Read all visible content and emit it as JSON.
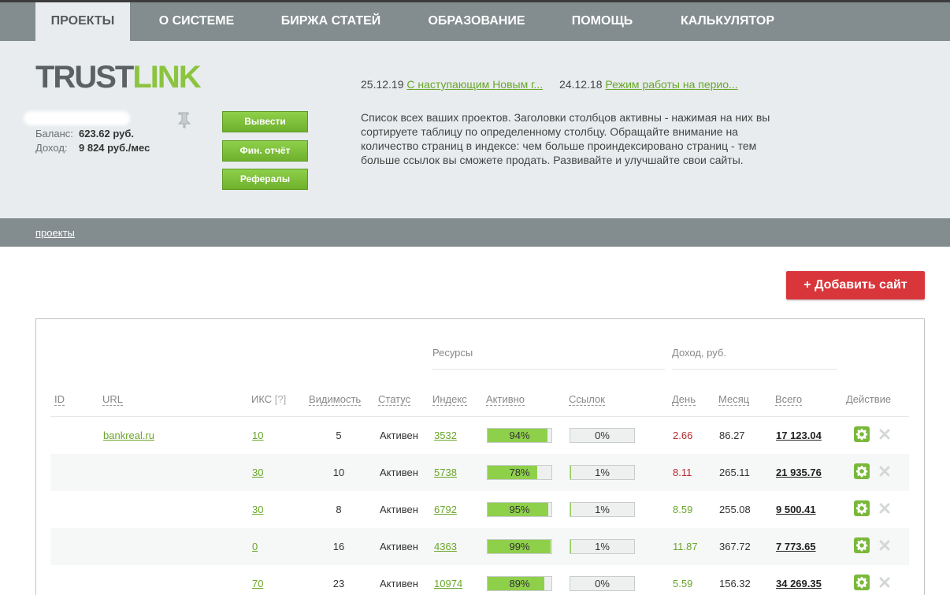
{
  "nav": {
    "tabs": [
      {
        "label": "ПРОЕКТЫ",
        "active": true
      },
      {
        "label": "О СИСТЕМЕ"
      },
      {
        "label": "БИРЖА СТАТЕЙ"
      },
      {
        "label": "ОБРАЗОВАНИЕ"
      },
      {
        "label": "ПОМОЩЬ"
      },
      {
        "label": "КАЛЬКУЛЯТОР"
      }
    ]
  },
  "header": {
    "logo_part1": "TRUST",
    "logo_part2": "LINK",
    "balance_label": "Баланс:",
    "balance_value": "623.62  руб.",
    "income_label": "Доход:",
    "income_value": "9 824 руб./мес",
    "buttons": {
      "withdraw": "Вывести",
      "report": "Фин. отчёт",
      "referrals": "Рефералы"
    },
    "news": [
      {
        "date": "25.12.19",
        "title": "С наступающим Новым г..."
      },
      {
        "date": "24.12.18",
        "title": "Режим работы на перио..."
      }
    ],
    "description": "Список всех ваших проектов. Заголовки столбцов активны - нажимая на них вы сортируете таблицу по определенному столбцу. Обращайте внимание на количество страниц в индексе: чем больше проиндексировано страниц - тем больше ссылок вы сможете продать. Развивайте и улучшайте свои сайты."
  },
  "breadcrumb": "проекты",
  "add_site_button": "+ Добавить сайт",
  "table": {
    "group_resources": "Ресурсы",
    "group_income": "Доход,  руб.",
    "columns": {
      "id": "ID",
      "url": "URL",
      "iks": "ИКС",
      "iks_hint": "[?]",
      "visibility": "Видимость",
      "status": "Статус",
      "index": "Индекс",
      "active": "Активно",
      "links": "Ссылок",
      "day": "День",
      "month": "Месяц",
      "total": "Всего",
      "action": "Действие"
    },
    "rows": [
      {
        "url": "bankreal.ru",
        "iks": "10",
        "visibility": "5",
        "status": "Активен",
        "index": "3532",
        "active": "94%",
        "active_frac": 0.94,
        "links": "0%",
        "links_frac": 0.0,
        "day": "2.66",
        "day_color": "red",
        "month": "86.27",
        "total": "17 123.04"
      },
      {
        "url": "",
        "iks": "30",
        "visibility": "10",
        "status": "Активен",
        "index": "5738",
        "active": "78%",
        "active_frac": 0.78,
        "links": "1%",
        "links_frac": 0.01,
        "day": "8.11",
        "day_color": "red",
        "month": "265.11",
        "total": "21 935.76"
      },
      {
        "url": "",
        "iks": "30",
        "visibility": "8",
        "status": "Активен",
        "index": "6792",
        "active": "95%",
        "active_frac": 0.95,
        "links": "1%",
        "links_frac": 0.01,
        "day": "8.59",
        "day_color": "green",
        "month": "255.08",
        "total": "9 500.41"
      },
      {
        "url": "",
        "iks": "0",
        "visibility": "16",
        "status": "Активен",
        "index": "4363",
        "active": "99%",
        "active_frac": 0.99,
        "links": "1%",
        "links_frac": 0.01,
        "day": "11.87",
        "day_color": "green",
        "month": "367.72",
        "total": "7 773.65"
      },
      {
        "url": "",
        "iks": "70",
        "visibility": "23",
        "status": "Активен",
        "index": "10974",
        "active": "89%",
        "active_frac": 0.89,
        "links": "0%",
        "links_frac": 0.0,
        "day": "5.59",
        "day_color": "green",
        "month": "156.32",
        "total": "34 269.35"
      }
    ]
  },
  "colors": {
    "accent_green": "#8fd04b",
    "link_green": "#6aa62a",
    "add_red": "#d8363a",
    "nav_gray": "#838c8e"
  }
}
